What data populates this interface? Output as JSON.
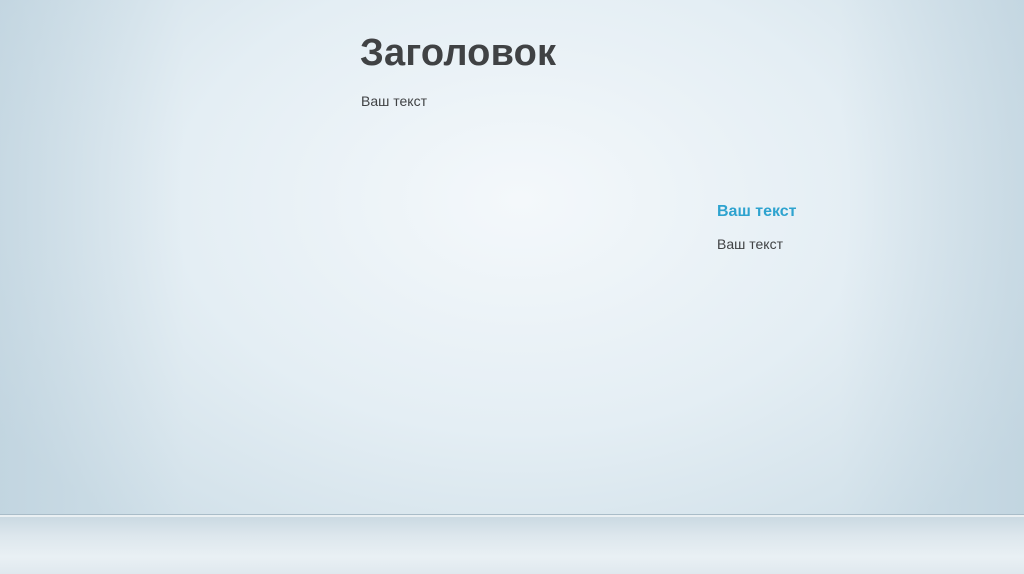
{
  "slide": {
    "title": "Заголовок",
    "body_text": "Ваш текст",
    "aside": {
      "heading": "Ваш текст",
      "text": "Ваш текст"
    }
  },
  "colors": {
    "title_text": "#404244",
    "accent_heading": "#2ea3cf",
    "body_text": "#404244"
  }
}
